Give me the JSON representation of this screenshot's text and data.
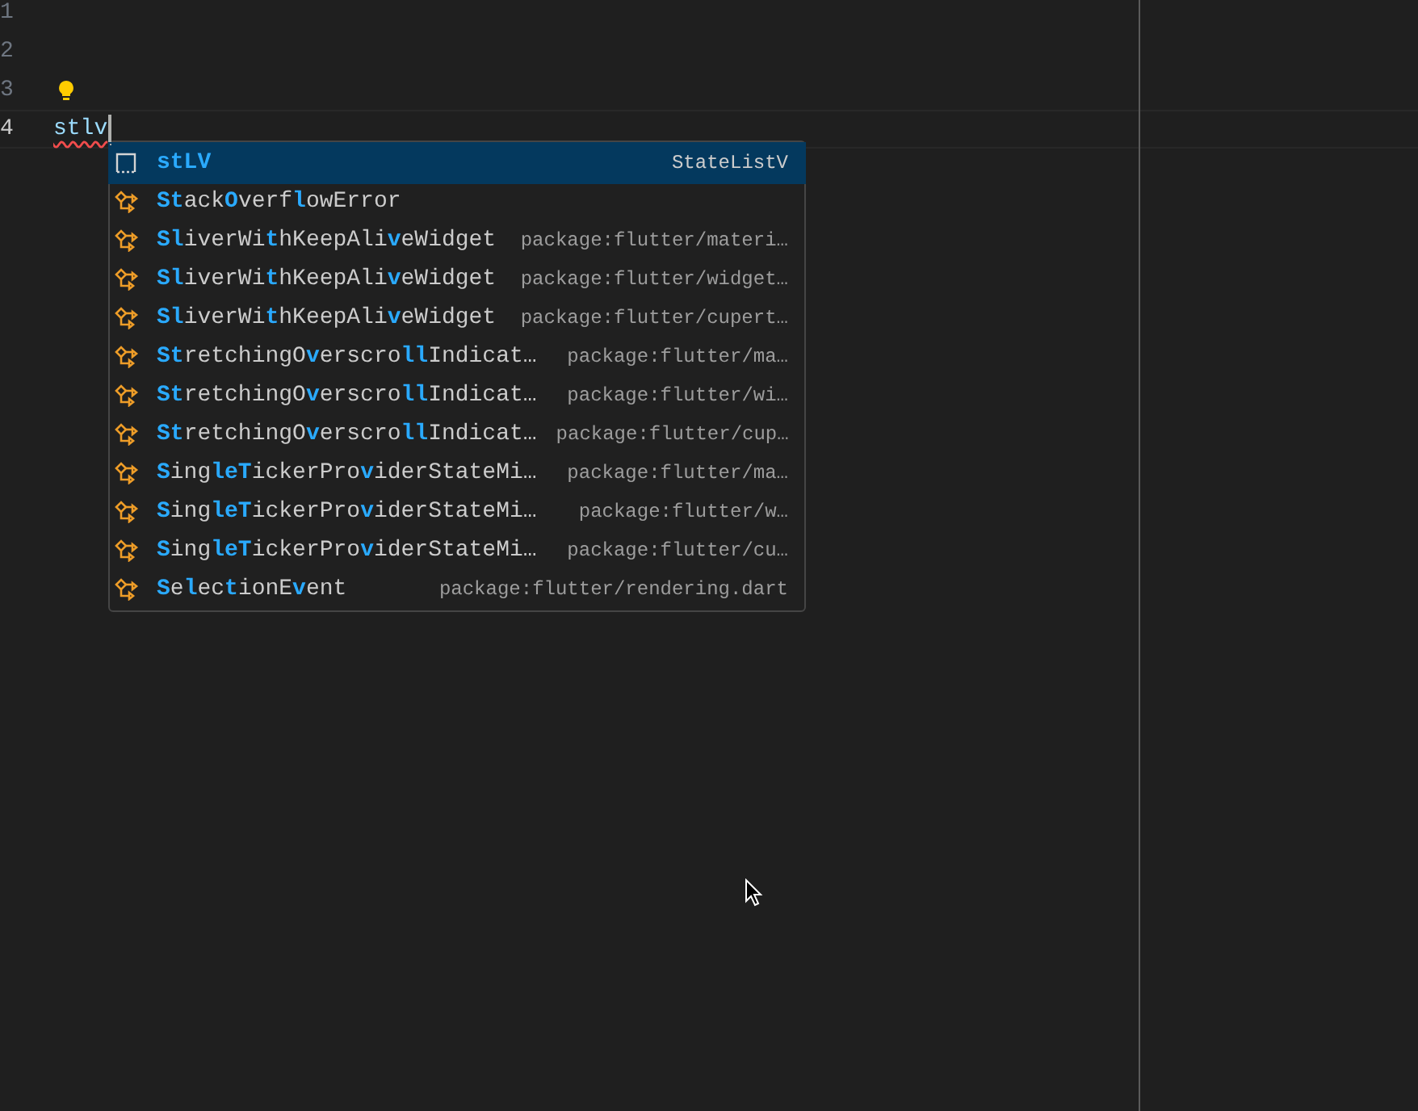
{
  "editor": {
    "line_numbers": [
      "1",
      "2",
      "3",
      "4"
    ],
    "current_line_text": "stlv",
    "has_lightbulb": true
  },
  "suggestions": [
    {
      "kind": "snippet",
      "label": "stLV",
      "detail": "StateListV",
      "selected": true
    },
    {
      "kind": "class",
      "label": "**St**ack**O**verf**l**owError",
      "selected": false
    },
    {
      "kind": "class",
      "label": "**Sl**iverWi**t**hKeepAli**v**eWidget",
      "detail": "package:flutter/materi…",
      "selected": false
    },
    {
      "kind": "class",
      "label": "**Sl**iverWi**t**hKeepAli**v**eWidget",
      "detail": "package:flutter/widget…",
      "selected": false
    },
    {
      "kind": "class",
      "label": "**Sl**iverWi**t**hKeepAli**v**eWidget",
      "detail": "package:flutter/cupert…",
      "selected": false
    },
    {
      "kind": "class",
      "label": "**St**retchingO**v**erscro**ll**Indicat…",
      "detail": "package:flutter/ma…",
      "selected": false
    },
    {
      "kind": "class",
      "label": "**St**retchingO**v**erscro**ll**Indicat…",
      "detail": "package:flutter/wi…",
      "selected": false
    },
    {
      "kind": "class",
      "label": "**St**retchingO**v**erscro**ll**Indicat…",
      "detail": "package:flutter/cup…",
      "selected": false
    },
    {
      "kind": "class",
      "label": "**S**ing**leT**ickerPro**v**iderStateMi…",
      "detail": "package:flutter/ma…",
      "selected": false
    },
    {
      "kind": "class",
      "label": "**S**ing**leT**ickerPro**v**iderStateMi…",
      "detail": "package:flutter/w…",
      "selected": false
    },
    {
      "kind": "class",
      "label": "**S**ing**leT**ickerPro**v**iderStateMi…",
      "detail": "package:flutter/cu…",
      "selected": false
    },
    {
      "kind": "class",
      "label": "**S**e**l**ec**t**ionE**v**ent",
      "detail": "package:flutter/rendering.dart",
      "selected": false
    }
  ]
}
